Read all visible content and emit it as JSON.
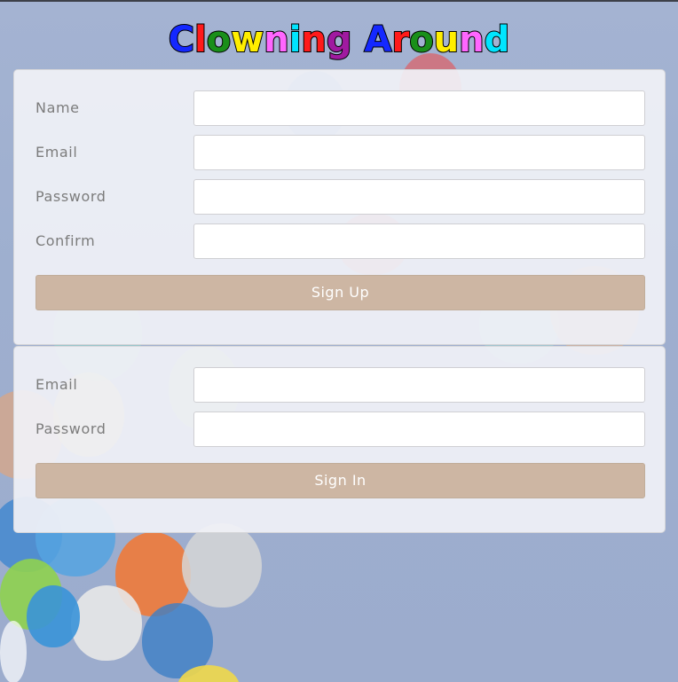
{
  "title": {
    "text": "Clowning Around",
    "letters": [
      {
        "ch": "C",
        "color": "#1428ff"
      },
      {
        "ch": "l",
        "color": "#ff1a1a"
      },
      {
        "ch": "o",
        "color": "#1a8f1a"
      },
      {
        "ch": "w",
        "color": "#ffee00"
      },
      {
        "ch": "n",
        "color": "#ff66ff"
      },
      {
        "ch": "i",
        "color": "#00e5ff"
      },
      {
        "ch": "n",
        "color": "#ff1a1a"
      },
      {
        "ch": "g",
        "color": "#a01aa0"
      },
      {
        "ch": " ",
        "color": "#000000"
      },
      {
        "ch": "A",
        "color": "#1428ff"
      },
      {
        "ch": "r",
        "color": "#ff1a1a"
      },
      {
        "ch": "o",
        "color": "#1a8f1a"
      },
      {
        "ch": "u",
        "color": "#ffee00"
      },
      {
        "ch": "n",
        "color": "#ff66ff"
      },
      {
        "ch": "d",
        "color": "#00e5ff"
      }
    ]
  },
  "signup": {
    "name_label": "Name",
    "name_value": "",
    "email_label": "Email",
    "email_value": "",
    "password_label": "Password",
    "password_value": "",
    "confirm_label": "Confirm",
    "confirm_value": "",
    "submit_label": "Sign Up"
  },
  "signin": {
    "email_label": "Email",
    "email_value": "",
    "password_label": "Password",
    "password_value": "",
    "submit_label": "Sign In"
  },
  "colors": {
    "button_bg": "#cdb6a3",
    "button_text": "#ffffff",
    "label_text": "#7c7c7c",
    "panel_bg": "#f0f1f6"
  }
}
